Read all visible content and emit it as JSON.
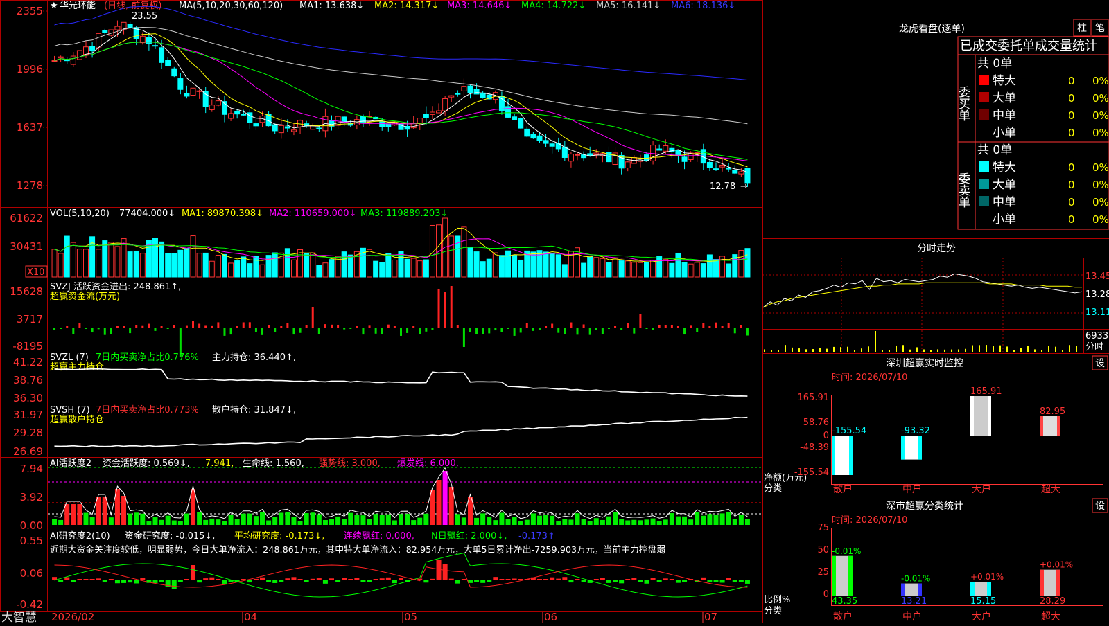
{
  "app": {
    "name": "大智慧"
  },
  "main_chart": {
    "stock_name": "华光环能",
    "period": "(日线, 前复权)",
    "ma_label": "MA(5,10,20,30,60,120)",
    "ma": [
      {
        "label": "MA1: 13.638↓",
        "color": "#ffffff"
      },
      {
        "label": "MA2: 14.317↓",
        "color": "#ffff00"
      },
      {
        "label": "MA3: 14.646↓",
        "color": "#ff00ff"
      },
      {
        "label": "MA4: 14.722↓",
        "color": "#00ff00"
      },
      {
        "label": "MA5: 16.141↓",
        "color": "#cccccc"
      },
      {
        "label": "MA6: 18.136↓",
        "color": "#2a2aff"
      }
    ],
    "yticks": [
      "2355",
      "1996",
      "1637",
      "1278"
    ],
    "high_note": "23.55",
    "low_note": "12.78"
  },
  "vol_panel": {
    "label": "VOL(5,10,20)",
    "value": "77404.000↓",
    "ma": [
      {
        "label": "MA1: 89870.398↓",
        "color": "#ffff00"
      },
      {
        "label": "MA2: 110659.000↓",
        "color": "#ff00ff"
      },
      {
        "label": "MA3: 119889.203↓",
        "color": "#00ff00"
      }
    ],
    "yticks": [
      "61622",
      "30431"
    ],
    "unit": "X10"
  },
  "svzj_panel": {
    "line1": "SVZJ  活跃资金进出: 248.861↑,",
    "line2": "超赢资金流(万元)",
    "yticks": [
      "15628",
      "3717",
      "-8195"
    ]
  },
  "svzl_panel": {
    "name": "SVZL (7)",
    "pct": "7日内买卖净占比0.776%",
    "hold": "主力持仓: 36.440↑,",
    "line2": "超赢主力持仓",
    "yticks": [
      "41.22",
      "38.76",
      "36.30"
    ]
  },
  "svsh_panel": {
    "name": "SVSH (7)",
    "pct": "7日内买卖净占比0.773%",
    "hold": "散户持仓: 31.847↓,",
    "line2": "超赢散户持仓",
    "yticks": [
      "31.97",
      "29.28",
      "26.69"
    ]
  },
  "ai_active_panel": {
    "name": "AI活跃度2",
    "active": "资金活跃度: 0.569↓,",
    "v2": "7.941,",
    "life": "生命线: 1.560,",
    "strong": "强势线: 3.000,",
    "burst": "爆发线: 6.000,",
    "yticks": [
      "7.94",
      "3.92",
      "0.00"
    ]
  },
  "ai_research_panel": {
    "name": "AI研究度2(10)",
    "fund": "资金研究度: -0.015↓,",
    "avg": "平均研究度: -0.173↓,",
    "cont": "连续飘红: 0.000,",
    "nday": "N日飘红: 2.000↓,",
    "last": "-0.173↑",
    "note": "近期大资金关注度较低，明显弱势，今日大单净流入：248.861万元，其中特大单净流入：82.954万元，大单5日累计净出-7259.903万元，当前主力控盘弱",
    "yticks": [
      "0.55",
      "0.06",
      "-0.42"
    ]
  },
  "xaxis": {
    "labels": [
      "2026/02",
      "04",
      "05",
      "06",
      "07"
    ]
  },
  "longhu": {
    "title": "龙虎看盘(逐单)",
    "tab1": "柱",
    "tab2": "笔",
    "header": "已成交委托单成交量统计",
    "buy_side": "委买单",
    "sell_side": "委卖单",
    "buy_total": "共 0单",
    "sell_total": "共 0单",
    "buy_rows": [
      {
        "label": "特大",
        "count": "0",
        "pct": "0%",
        "color": "#ff0000"
      },
      {
        "label": "大单",
        "count": "0",
        "pct": "0%",
        "color": "#b00000"
      },
      {
        "label": "中单",
        "count": "0",
        "pct": "0%",
        "color": "#700000"
      },
      {
        "label": "小单",
        "count": "0",
        "pct": "0%",
        "color": ""
      }
    ],
    "sell_rows": [
      {
        "label": "特大",
        "count": "0",
        "pct": "0%",
        "color": "#00ffff"
      },
      {
        "label": "大单",
        "count": "0",
        "pct": "0%",
        "color": "#009999"
      },
      {
        "label": "中单",
        "count": "0",
        "pct": "0%",
        "color": "#006666"
      },
      {
        "label": "小单",
        "count": "0",
        "pct": "0%",
        "color": ""
      }
    ]
  },
  "intraday": {
    "title": "分时走势",
    "price_ticks": [
      "13.45",
      "13.28",
      "13.11"
    ],
    "vol_tick": "6933",
    "tab_label": "分时"
  },
  "sz_monitor": {
    "title": "深圳超赢实时监控",
    "set_label": "设",
    "time": "时间: 2026/07/10",
    "yticks": [
      "165.91",
      "58.76",
      "0",
      "-48.39",
      "-155.54"
    ],
    "ylabel": "净额(万元)",
    "xlabel": "分类",
    "categories": [
      "散户",
      "中户",
      "大户",
      "超大"
    ],
    "value_labels": [
      "-155.54",
      "-93.32",
      "165.91",
      "82.95"
    ]
  },
  "sz_category": {
    "title": "深市超赢分类统计",
    "set_label": "设",
    "time": "时间: 2026/07/10",
    "yticks": [
      "75",
      "50",
      "25",
      "0"
    ],
    "ylabel": "比例%",
    "xlabel": "分类",
    "categories": [
      "散户",
      "中户",
      "大户",
      "超大"
    ],
    "value_labels": [
      "43.35",
      "13.21",
      "15.15",
      "28.29"
    ],
    "change_labels": [
      "-0.01%",
      "-0.01%",
      "+0.01%",
      "+0.01%"
    ]
  },
  "chart_data": [
    {
      "type": "bar",
      "title": "深圳超赢实时监控",
      "ylabel": "净额(万元)",
      "categories": [
        "散户",
        "中户",
        "大户",
        "超大"
      ],
      "values": [
        -155.54,
        -93.32,
        165.91,
        82.95
      ],
      "ylim": [
        -155.54,
        165.91
      ],
      "colors": [
        "#00ffff",
        "#00ffff",
        "#ffffff",
        "#ff4444"
      ]
    },
    {
      "type": "bar",
      "title": "深市超赢分类统计",
      "ylabel": "比例%",
      "categories": [
        "散户",
        "中户",
        "大户",
        "超大"
      ],
      "values": [
        43.35,
        13.21,
        15.15,
        28.29
      ],
      "ylim": [
        0,
        75
      ],
      "colors": [
        "#00ff00",
        "#3333ff",
        "#00ffff",
        "#ff3333"
      ]
    },
    {
      "type": "line",
      "title": "分时走势",
      "price_range": [
        13.11,
        13.45
      ],
      "series": [
        {
          "values": [
            13.16,
            13.21,
            13.18,
            13.24,
            13.22,
            13.27,
            13.25,
            13.3,
            13.31,
            13.33,
            13.36,
            13.34,
            13.38,
            13.37,
            13.4,
            13.32,
            13.42,
            13.39,
            13.4,
            13.38,
            13.41,
            13.4,
            13.39,
            13.4,
            13.41,
            13.44,
            13.43,
            13.46,
            13.45,
            13.44,
            13.42,
            13.39,
            13.38,
            13.37,
            13.36,
            13.35,
            13.36,
            13.34,
            13.33,
            13.34,
            13.33,
            13.32,
            13.31,
            13.3,
            13.29,
            13.3
          ]
        },
        {
          "values": [
            13.16,
            13.19,
            13.21,
            13.22,
            13.24,
            13.25,
            13.26,
            13.27,
            13.28,
            13.29,
            13.3,
            13.31,
            13.32,
            13.33,
            13.34,
            13.35,
            13.35,
            13.36,
            13.36,
            13.37,
            13.37,
            13.37,
            13.37,
            13.38,
            13.38,
            13.38,
            13.38,
            13.38,
            13.38,
            13.38,
            13.38,
            13.38,
            13.37,
            13.37,
            13.37,
            13.37,
            13.36,
            13.36,
            13.36,
            13.36,
            13.35,
            13.35,
            13.35,
            13.35,
            13.34,
            13.34
          ]
        }
      ]
    }
  ]
}
